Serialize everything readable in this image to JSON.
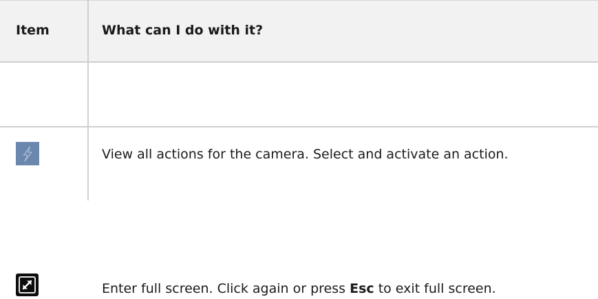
{
  "table": {
    "headers": {
      "item": "Item",
      "description": "What can I do with it?"
    },
    "rows": [
      {
        "icon": "lightning-bolt-icon",
        "description": "View all actions for the camera. Select and activate an action."
      },
      {
        "icon": "fullscreen-expand-icon",
        "description_before": "Enter full screen. Click again or press ",
        "description_key": "Esc",
        "description_after": " to exit full screen."
      }
    ]
  },
  "colors": {
    "header_background": "#f2f2f2",
    "actions_icon_background": "#6b87ad",
    "fullscreen_icon_background": "#0d0d0d",
    "grid_lines": "#cfcfcf"
  }
}
